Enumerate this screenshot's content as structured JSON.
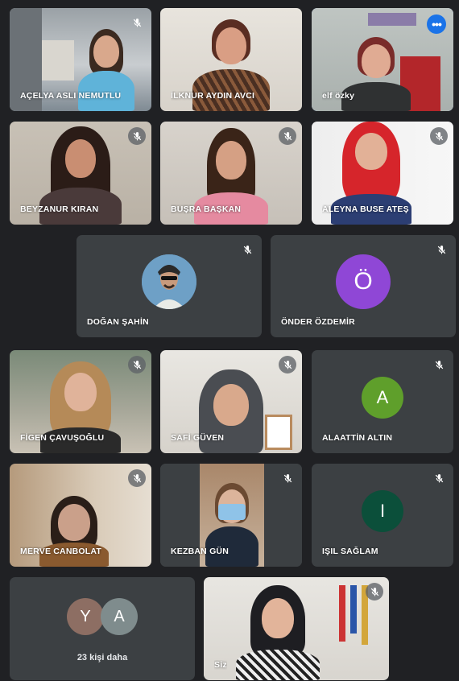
{
  "participants": [
    {
      "name": "AÇELYA ASLI NEMUTLU",
      "muted": true
    },
    {
      "name": "İLKNUR AYDIN AVCI",
      "muted": false
    },
    {
      "name": "elf özky",
      "muted": false,
      "pinned_menu": "•••"
    },
    {
      "name": "BEYZANUR KIRAN",
      "muted": true
    },
    {
      "name": "BUŞRA BAŞKAN",
      "muted": true
    },
    {
      "name": "ALEYNA BUSE ATEŞ",
      "muted": true
    },
    {
      "name": "DOĞAN ŞAHİN",
      "muted": true
    },
    {
      "name": "ÖNDER ÖZDEMİR",
      "muted": true,
      "initial": "Ö",
      "avatar_color": "#8f47d6"
    },
    {
      "name": "FİGEN ÇAVUŞOĞLU",
      "muted": true
    },
    {
      "name": "SAFİ GÜVEN",
      "muted": true
    },
    {
      "name": "ALAATTİN ALTIN",
      "muted": true,
      "initial": "A",
      "avatar_color": "#5f9f2b"
    },
    {
      "name": "MERVE CANBOLAT",
      "muted": true
    },
    {
      "name": "KEZBAN GÜN",
      "muted": true
    },
    {
      "name": "IŞIL SAĞLAM",
      "muted": true,
      "initial": "I",
      "avatar_color": "#0b4f3a"
    },
    {
      "name": "Siz",
      "muted": true
    }
  ],
  "overflow": {
    "label": "23 kişi daha",
    "avatars": [
      {
        "initial": "Y",
        "color": "#8d6e63"
      },
      {
        "initial": "A",
        "color": "#7f8c8d"
      }
    ]
  },
  "colors": {
    "background": "#202124",
    "tile": "#3c4043",
    "active_outline": "#8ab4f8",
    "menu_button": "#1a73e8"
  },
  "icons": {
    "mute": "mic-off-icon",
    "menu": "more-options-icon"
  }
}
